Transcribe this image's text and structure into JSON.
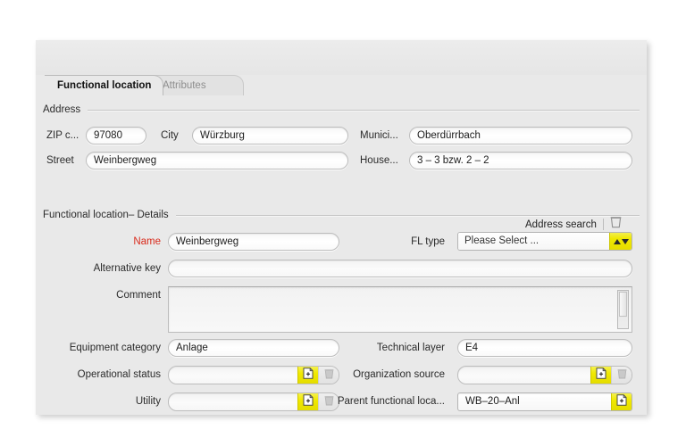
{
  "window": {
    "tabs": [
      {
        "label": "Functional location",
        "active": true
      },
      {
        "label": "Attributes",
        "active": false
      }
    ]
  },
  "address_section": {
    "title": "Address",
    "fields": {
      "zip_label": "ZIP c...",
      "zip_value": "97080",
      "city_label": "City",
      "city_value": "Würzburg",
      "municipality_label": "Munici...",
      "municipality_value": "Oberdürrbach",
      "street_label": "Street",
      "street_value": "Weinbergweg",
      "house_label": "House...",
      "house_value": "3 – 3 bzw. 2 – 2"
    },
    "actions": {
      "address_search_label": "Address search",
      "delete_icon": "trash-icon"
    }
  },
  "details_section": {
    "title": "Functional location– Details",
    "name_label": "Name",
    "name_value": "Weinbergweg",
    "fl_type_label": "FL type",
    "fl_type_value": "Please Select ...",
    "fl_type_button_icon": "updown-arrows-icon",
    "alternative_key_label": "Alternative key",
    "alternative_key_value": "",
    "comment_label": "Comment",
    "comment_value": "",
    "equipment_category_label": "Equipment category",
    "equipment_category_value": "Anlage",
    "technical_layer_label": "Technical layer",
    "technical_layer_value": "E4",
    "operational_status_label": "Operational status",
    "operational_status_value": "",
    "organization_source_label": "Organization source",
    "organization_source_value": "",
    "utility_label": "Utility",
    "utility_value": "",
    "parent_functional_location_label": "Parent functional loca...",
    "parent_functional_location_value": "WB–20–Anl",
    "add_icon": "page-plus-icon",
    "delete_icon": "trash-icon"
  },
  "colors": {
    "accent_yellow": "#efe800",
    "required_red": "#d92b1c",
    "panel_bg": "#e9e9e9"
  }
}
